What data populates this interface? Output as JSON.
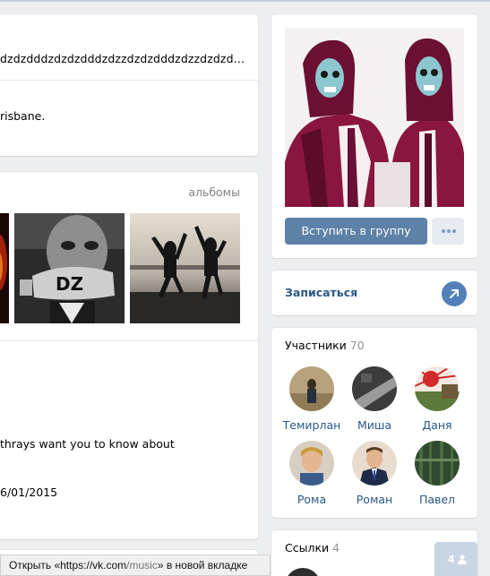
{
  "status": {
    "text": "dzdzdddzdzdzdddzdzzdzdzdddzdzzdzdzd…",
    "city": "risbane."
  },
  "albums": {
    "link": "альбомы",
    "photos": [
      {
        "name": "fire-photo"
      },
      {
        "name": "face-dz-photo"
      },
      {
        "name": "jumping-photo"
      }
    ]
  },
  "info": {
    "line1": "thrays want you to know about",
    "line2": "6/01/2015"
  },
  "group": {
    "join_label": "Вступить в группу"
  },
  "subscribe": {
    "label": "Записаться"
  },
  "members": {
    "title": "Участники",
    "count": "70",
    "list": [
      {
        "name": "Темирлан"
      },
      {
        "name": "Миша"
      },
      {
        "name": "Даня"
      },
      {
        "name": "Рома"
      },
      {
        "name": "Роман"
      },
      {
        "name": "Павел"
      }
    ]
  },
  "links": {
    "title": "Ссылки",
    "count": "4"
  },
  "tooltip": {
    "prefix": "Открыть «https://vk.com",
    "path": "/music",
    "suffix": "» в новой вкладке"
  },
  "chat": {
    "count": "4"
  },
  "colors": {
    "accent": "#5e81a8",
    "link": "#2a5885",
    "background": "#edeef0"
  }
}
